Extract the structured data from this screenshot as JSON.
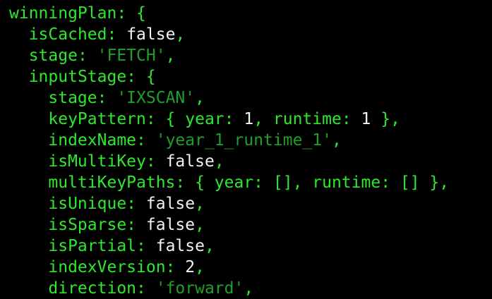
{
  "colors": {
    "background": "#000000",
    "key_green": "#2ee82e",
    "string_green": "#1f9e2a",
    "value_white": "#f2f2f2"
  },
  "lines": [
    {
      "indent": "",
      "parts": [
        {
          "t": "k",
          "text": "winningPlan: {"
        }
      ]
    },
    {
      "indent": "  ",
      "parts": [
        {
          "t": "k",
          "text": "isCached: "
        },
        {
          "t": "v",
          "text": "false"
        },
        {
          "t": "k",
          "text": ","
        }
      ]
    },
    {
      "indent": "  ",
      "parts": [
        {
          "t": "k",
          "text": "stage: "
        },
        {
          "t": "s",
          "text": "'FETCH'"
        },
        {
          "t": "k",
          "text": ","
        }
      ]
    },
    {
      "indent": "  ",
      "parts": [
        {
          "t": "k",
          "text": "inputStage: {"
        }
      ]
    },
    {
      "indent": "    ",
      "parts": [
        {
          "t": "k",
          "text": "stage: "
        },
        {
          "t": "s",
          "text": "'IXSCAN'"
        },
        {
          "t": "k",
          "text": ","
        }
      ]
    },
    {
      "indent": "    ",
      "parts": [
        {
          "t": "k",
          "text": "keyPattern: { year: "
        },
        {
          "t": "v",
          "text": "1"
        },
        {
          "t": "k",
          "text": ", runtime: "
        },
        {
          "t": "v",
          "text": "1"
        },
        {
          "t": "k",
          "text": " },"
        }
      ]
    },
    {
      "indent": "    ",
      "parts": [
        {
          "t": "k",
          "text": "indexName: "
        },
        {
          "t": "s",
          "text": "'year_1_runtime_1'"
        },
        {
          "t": "k",
          "text": ","
        }
      ]
    },
    {
      "indent": "    ",
      "parts": [
        {
          "t": "k",
          "text": "isMultiKey: "
        },
        {
          "t": "v",
          "text": "false"
        },
        {
          "t": "k",
          "text": ","
        }
      ]
    },
    {
      "indent": "    ",
      "parts": [
        {
          "t": "k",
          "text": "multiKeyPaths: { year: [], runtime: [] },"
        }
      ]
    },
    {
      "indent": "    ",
      "parts": [
        {
          "t": "k",
          "text": "isUnique: "
        },
        {
          "t": "v",
          "text": "false"
        },
        {
          "t": "k",
          "text": ","
        }
      ]
    },
    {
      "indent": "    ",
      "parts": [
        {
          "t": "k",
          "text": "isSparse: "
        },
        {
          "t": "v",
          "text": "false"
        },
        {
          "t": "k",
          "text": ","
        }
      ]
    },
    {
      "indent": "    ",
      "parts": [
        {
          "t": "k",
          "text": "isPartial: "
        },
        {
          "t": "v",
          "text": "false"
        },
        {
          "t": "k",
          "text": ","
        }
      ]
    },
    {
      "indent": "    ",
      "parts": [
        {
          "t": "k",
          "text": "indexVersion: "
        },
        {
          "t": "v",
          "text": "2"
        },
        {
          "t": "k",
          "text": ","
        }
      ]
    },
    {
      "indent": "    ",
      "parts": [
        {
          "t": "k",
          "text": "direction: "
        },
        {
          "t": "s",
          "text": "'forward'"
        },
        {
          "t": "k",
          "text": ","
        }
      ]
    }
  ]
}
